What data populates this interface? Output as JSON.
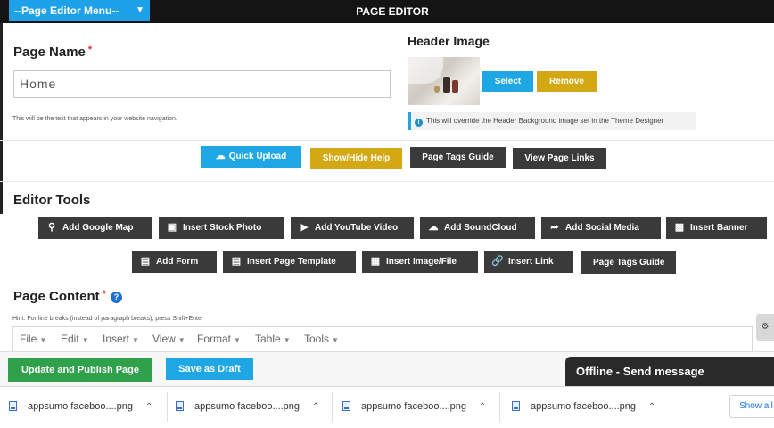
{
  "topbar": {
    "menu_label": "--Page Editor Menu--",
    "title": "PAGE EDITOR"
  },
  "page_name": {
    "label": "Page Name",
    "required_mark": "*",
    "value": "Home",
    "hint": "This will be the text that appears in your website navigation."
  },
  "header_image": {
    "label": "Header Image",
    "select_label": "Select",
    "remove_label": "Remove",
    "info": "This will override the Header Background image set in the Theme Designer"
  },
  "actions": {
    "quick_upload": "Quick Upload",
    "show_hide_help": "Show/Hide Help",
    "page_tags_guide": "Page Tags Guide",
    "view_page_links": "View Page Links"
  },
  "editor_tools": {
    "label": "Editor Tools",
    "row1": [
      {
        "label": "Add Google Map",
        "icon": "map-pin-icon"
      },
      {
        "label": "Insert Stock Photo",
        "icon": "camera-icon"
      },
      {
        "label": "Add YouTube Video",
        "icon": "youtube-icon"
      },
      {
        "label": "Add SoundCloud",
        "icon": "soundcloud-icon"
      },
      {
        "label": "Add Social Media",
        "icon": "share-icon"
      },
      {
        "label": "Insert Banner",
        "icon": "banner-icon"
      }
    ],
    "row2": [
      {
        "label": "Add Form",
        "icon": "form-icon"
      },
      {
        "label": "Insert Page Template",
        "icon": "template-icon"
      },
      {
        "label": "Insert Image/File",
        "icon": "image-icon"
      },
      {
        "label": "Insert Link",
        "icon": "link-icon"
      },
      {
        "label": "Page Tags Guide",
        "icon": ""
      }
    ]
  },
  "page_content": {
    "label": "Page Content",
    "required_mark": "*",
    "hint": "Hint: For line breaks (instead of paragraph breaks), press Shift+Enter",
    "menubar": [
      "File",
      "Edit",
      "Insert",
      "View",
      "Format",
      "Table",
      "Tools"
    ]
  },
  "footer": {
    "update_publish": "Update and Publish Page",
    "save_draft": "Save as Draft",
    "offline": "Offline - Send message"
  },
  "downloads": {
    "items": [
      "appsumo faceboo....png",
      "appsumo faceboo....png",
      "appsumo faceboo....png",
      "appsumo faceboo....png"
    ],
    "show_all": "Show all"
  },
  "colors": {
    "accent_blue": "#1ea7e4",
    "accent_gold": "#d4a813",
    "button_dark": "#3a3a3a",
    "publish_green": "#2fa14a",
    "topbar": "#141414"
  }
}
